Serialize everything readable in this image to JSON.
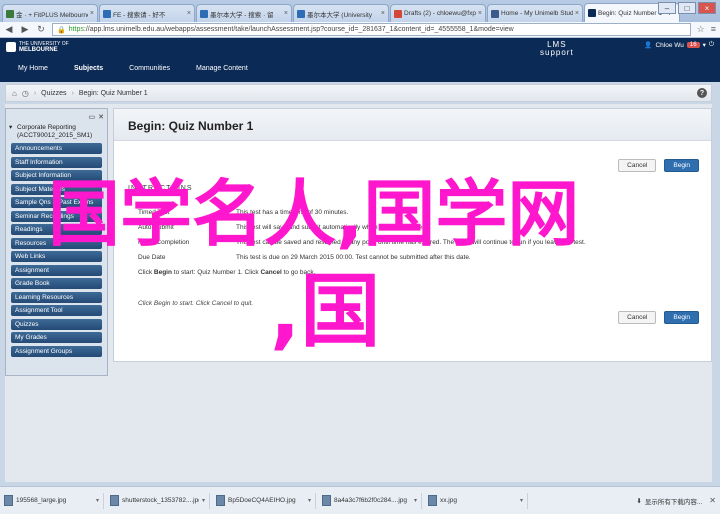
{
  "tabs": [
    {
      "label": "金 · + FitPLUS Melbourne",
      "color": "#3b7a3b",
      "active": false
    },
    {
      "label": "FE - 搜索请 - 好不",
      "color": "#2c6db5",
      "active": false
    },
    {
      "label": "墨尔本大学 - 搜索 · 留",
      "color": "#2c6db5",
      "active": false
    },
    {
      "label": "墨尔本大学 (University",
      "color": "#2c6db5",
      "active": false
    },
    {
      "label": "Drafts (2) - chloewu@fxpi",
      "color": "#d44638",
      "active": false
    },
    {
      "label": "Home - My Unimelb Studies",
      "color": "#3a5a8c",
      "active": false
    },
    {
      "label": "Begin: Quiz Number 1 – ACC",
      "color": "#0b2a55",
      "active": true
    }
  ],
  "window_controls": {
    "minimize": "–",
    "maximize": "□",
    "close": "×"
  },
  "address": {
    "protocol": "https",
    "rest": "://app.lms.unimelb.edu.au/webapps/assessment/take/launchAssessment.jsp?course_id=_281637_1&content_id=_4555558_1&mode=view"
  },
  "header": {
    "uni_line1": "THE UNIVERSITY OF",
    "uni_line2": "MELBOURNE",
    "lms_line1": "LMS",
    "lms_line2": "support",
    "user": "Chloe Wu",
    "badge": "16"
  },
  "nav": [
    "My Home",
    "Subjects",
    "Communities",
    "Manage Content"
  ],
  "breadcrumb": {
    "parent": "Quizzes",
    "current": "Begin: Quiz Number 1"
  },
  "sidebar": {
    "course_line1": "Corporate Reporting",
    "course_line2": "(ACCT90012_2015_SM1)",
    "items": [
      "Announcements",
      "Staff Information",
      "Subject Information",
      "Subject Materials",
      "Sample Qns & Past Exams",
      "Seminar Recordings",
      "Readings",
      "Resources",
      "Web Links",
      "Assignment",
      "Grade Book",
      "Learning Resources",
      "Assignment Tool",
      "Quizzes",
      "My Grades",
      "Assignment Groups"
    ]
  },
  "main": {
    "title": "Begin: Quiz Number 1",
    "cancel": "Cancel",
    "begin": "Begin",
    "instructions_heading": "INSTRUCTIONS",
    "rows": [
      {
        "k": "Timed Test",
        "v": "This test has a time limit of 30 minutes."
      },
      {
        "k": "Auto-Submit",
        "v": "This test will save and submit automatically when the time expires."
      },
      {
        "k": "Force Completion",
        "v": "This test can be saved and resumed at any point until time has expired. The timer will continue to run if you leave the test."
      },
      {
        "k": "Due Date",
        "v": "This test is due on 29 March 2015 00:00. Test cannot be submitted after this date."
      }
    ],
    "click_prefix": "Click ",
    "click_begin": "Begin",
    "click_mid": " to start: Quiz Number 1. Click ",
    "click_cancel": "Cancel",
    "click_suffix": " to go back.",
    "hint": "Click Begin to start. Click Cancel to quit."
  },
  "watermark": {
    "line1": "国学名人,国学网",
    "line2": ",国"
  },
  "downloads": [
    {
      "name": "195568_large.jpg"
    },
    {
      "name": "shutterstock_1353782....jpg"
    },
    {
      "name": "Bp5DoeCQ4AEIHO.jpg"
    },
    {
      "name": "8a4a3c7f6b2f0c284....jpg"
    },
    {
      "name": "xx.jpg"
    }
  ],
  "downloads_show_all": "显示所有下载内容..."
}
